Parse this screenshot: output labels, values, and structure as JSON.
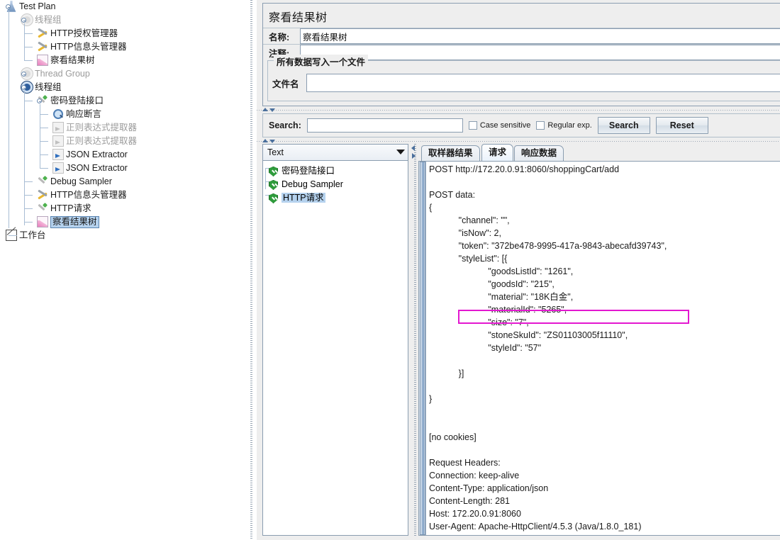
{
  "tree": {
    "items": [
      {
        "label": "Test Plan",
        "icon": "test-plan-icon",
        "depth": 0,
        "disabled": false,
        "selected": false
      },
      {
        "label": "线程组",
        "icon": "thread-group-icon-off",
        "depth": 1,
        "disabled": true,
        "selected": false
      },
      {
        "label": "HTTP授权管理器",
        "icon": "auth-manager-icon",
        "depth": 2,
        "disabled": false,
        "selected": false
      },
      {
        "label": "HTTP信息头管理器",
        "icon": "header-manager-icon",
        "depth": 2,
        "disabled": false,
        "selected": false
      },
      {
        "label": "察看结果树",
        "icon": "view-results-tree-icon",
        "depth": 2,
        "disabled": false,
        "selected": false
      },
      {
        "label": "Thread Group",
        "icon": "thread-group-icon-off",
        "depth": 1,
        "disabled": true,
        "selected": false
      },
      {
        "label": "线程组",
        "icon": "thread-group-icon-on",
        "depth": 1,
        "disabled": false,
        "selected": false
      },
      {
        "label": "密码登陆接口",
        "icon": "http-sampler-icon",
        "depth": 2,
        "disabled": false,
        "selected": false
      },
      {
        "label": "响应断言",
        "icon": "response-assertion-icon",
        "depth": 3,
        "disabled": false,
        "selected": false
      },
      {
        "label": "正则表达式提取器",
        "icon": "regex-extractor-icon-disabled",
        "depth": 3,
        "disabled": true,
        "selected": false
      },
      {
        "label": "正则表达式提取器",
        "icon": "regex-extractor-icon-disabled",
        "depth": 3,
        "disabled": true,
        "selected": false
      },
      {
        "label": "JSON Extractor",
        "icon": "json-extractor-icon",
        "depth": 3,
        "disabled": false,
        "selected": false
      },
      {
        "label": "JSON Extractor",
        "icon": "json-extractor-icon",
        "depth": 3,
        "disabled": false,
        "selected": false
      },
      {
        "label": "Debug Sampler",
        "icon": "debug-sampler-icon",
        "depth": 2,
        "disabled": false,
        "selected": false
      },
      {
        "label": "HTTP信息头管理器",
        "icon": "header-manager-icon",
        "depth": 2,
        "disabled": false,
        "selected": false
      },
      {
        "label": "HTTP请求",
        "icon": "http-sampler-icon",
        "depth": 2,
        "disabled": false,
        "selected": false
      },
      {
        "label": "察看结果树",
        "icon": "view-results-tree-icon",
        "depth": 2,
        "disabled": false,
        "selected": true
      },
      {
        "label": "工作台",
        "icon": "workbench-icon",
        "depth": 0,
        "disabled": false,
        "selected": false
      }
    ]
  },
  "config": {
    "panel_title": "察看结果树",
    "name_label": "名称:",
    "name_value": "察看结果树",
    "comment_label": "注释:",
    "comment_value": "",
    "file_group_title": "所有数据写入一个文件",
    "filename_label": "文件名",
    "filename_value": ""
  },
  "search": {
    "label": "Search:",
    "value": "",
    "case_sensitive_label": "Case sensitive",
    "case_sensitive_checked": false,
    "regular_exp_label": "Regular exp.",
    "regular_exp_checked": false,
    "search_button": "Search",
    "reset_button": "Reset"
  },
  "results": {
    "renderer_value": "Text",
    "items": [
      {
        "label": "密码登陆接口",
        "status": "success",
        "selected": false
      },
      {
        "label": "Debug Sampler",
        "status": "success",
        "selected": false
      },
      {
        "label": "HTTP请求",
        "status": "success",
        "selected": true
      }
    ]
  },
  "tabs": [
    {
      "label": "取样器结果",
      "active": false
    },
    {
      "label": "请求",
      "active": true
    },
    {
      "label": "响应数据",
      "active": false
    }
  ],
  "request": {
    "body": "POST http://172.20.0.91:8060/shoppingCart/add\n\nPOST data:\n{\n            \"channel\": \"\",\n            \"isNow\": 2,\n            \"token\": \"372be478-9995-417a-9843-abecafd39743\",\n            \"styleList\": [{\n                        \"goodsListId\": \"1261\",\n                        \"goodsId\": \"215\",\n                        \"material\": \"18K白金\",\n                        \"materialId\": \"5265\",\n                        \"size\": \"7\",\n                        \"stoneSkuId\": \"ZS01103005f11110\",\n                        \"styleId\": \"57\"\n\n            }]\n\n}\n\n\n[no cookies]\n\nRequest Headers:\nConnection: keep-alive\nContent-Type: application/json\nContent-Length: 281\nHost: 172.20.0.91:8060\nUser-Agent: Apache-HttpClient/4.5.3 (Java/1.8.0_181)",
    "url": "POST http://172.20.0.91:8060/shoppingCart/add",
    "post_data_label": "POST data:",
    "cookies": "[no cookies]",
    "headers_label": "Request Headers:",
    "headers": [
      "Connection: keep-alive",
      "Content-Type: application/json",
      "Content-Length: 281",
      "Host: 172.20.0.91:8060",
      "User-Agent: Apache-HttpClient/4.5.3 (Java/1.8.0_181)"
    ],
    "json": {
      "channel": "",
      "isNow": "2",
      "token": "372be478-9995-417a-9843-abecafd39743",
      "styleList": {
        "goodsListId": "1261",
        "goodsId": "215",
        "material": "18K白金",
        "materialId": "5265",
        "size": "7",
        "stoneSkuId": "ZS01103005f11110",
        "styleId": "57"
      }
    },
    "highlight_color": "#e318d0",
    "highlighted_text": "\"token\": \"372be478-9995-417a-9843-abecafd39743\","
  }
}
